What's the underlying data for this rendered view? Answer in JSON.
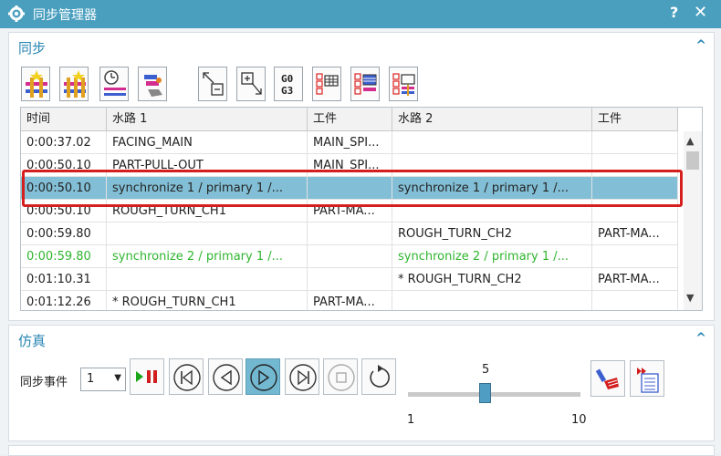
{
  "window": {
    "title": "同步管理器",
    "help_label": "?",
    "close_label": "✕"
  },
  "sync_section": {
    "title": "同步"
  },
  "toolbar": {
    "g0g3_line1": "G0",
    "g0g3_line2": "G3"
  },
  "grid": {
    "columns": [
      "时间",
      "水路 1",
      "工件",
      "水路 2",
      "工件"
    ],
    "rows": [
      {
        "time": "0:00:37.02",
        "ch1": "FACING_MAIN",
        "wp1": "MAIN_SPI...",
        "ch2": "",
        "wp2": ""
      },
      {
        "time": "0:00:50.10",
        "ch1": "PART-PULL-OUT",
        "wp1": "MAIN_SPI...",
        "ch2": "",
        "wp2": ""
      },
      {
        "time": "0:00:50.10",
        "ch1": "synchronize 1 / primary 1 /...",
        "wp1": "",
        "ch2": "synchronize 1 / primary 1 /...",
        "wp2": ""
      },
      {
        "time": "0:00:50.10",
        "ch1": "ROUGH_TURN_CH1",
        "wp1": "PART-MA...",
        "ch2": "",
        "wp2": ""
      },
      {
        "time": "0:00:59.80",
        "ch1": "",
        "wp1": "",
        "ch2": "ROUGH_TURN_CH2",
        "wp2": "PART-MA..."
      },
      {
        "time": "0:00:59.80",
        "ch1": "synchronize 2 / primary 1 /...",
        "wp1": "",
        "ch2": "synchronize 2 / primary 1 /...",
        "wp2": ""
      },
      {
        "time": "0:01:10.31",
        "ch1": "",
        "wp1": "",
        "ch2": "*  ROUGH_TURN_CH2",
        "wp2": "PART-MA..."
      },
      {
        "time": "0:01:12.26",
        "ch1": "*  ROUGH_TURN_CH1",
        "wp1": "PART-MA...",
        "ch2": "",
        "wp2": ""
      }
    ],
    "selected_row": 2,
    "highlighted_row": 5,
    "highlight_color": "#2fb52f",
    "selection_color": "#82bfd6"
  },
  "sim_section": {
    "title": "仿真",
    "sync_event_label": "同步事件",
    "sync_event_value": "1",
    "slider": {
      "min_label": "1",
      "max_label": "10",
      "value_label": "5",
      "value": 5,
      "min": 1,
      "max": 10
    }
  },
  "colors": {
    "titlebar": "#4a9fbf",
    "accent": "#2a86b3",
    "highlight_box": "#d51f1f"
  }
}
